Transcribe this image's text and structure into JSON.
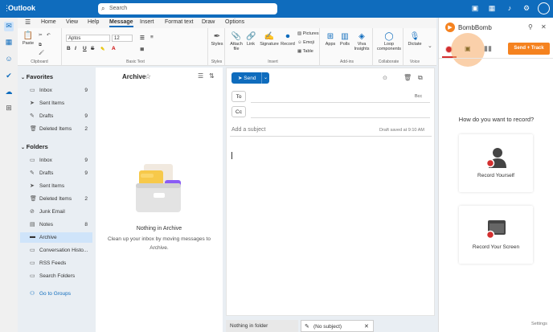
{
  "app": {
    "title": "Outlook"
  },
  "search": {
    "placeholder": "Search"
  },
  "ribbon": {
    "tabs": [
      "Home",
      "View",
      "Help",
      "Message",
      "Insert",
      "Format text",
      "Draw",
      "Options"
    ],
    "active_tab": "Message",
    "groups": {
      "clipboard": {
        "label": "Clipboard",
        "paste": "Paste"
      },
      "basic_text": {
        "label": "Basic Text",
        "font": "Aptos",
        "size": "12"
      },
      "styles": {
        "label": "Styles",
        "styles_btn": "Styles"
      },
      "insert": {
        "label": "Insert",
        "attach": "Attach file",
        "link": "Link",
        "signature": "Signature",
        "record": "Record",
        "pictures": "Pictures",
        "emoji": "Emoji",
        "table": "Table"
      },
      "addins": {
        "label": "Add-ins",
        "apps": "Apps",
        "polls": "Polls",
        "viva": "Viva Insights"
      },
      "collaborate": {
        "label": "Collaborate",
        "loop": "Loop components"
      },
      "voice": {
        "label": "Voice",
        "dictate": "Dictate"
      }
    }
  },
  "folders": {
    "favorites_header": "Favorites",
    "favorites": [
      {
        "label": "Inbox",
        "count": "9"
      },
      {
        "label": "Sent Items",
        "count": ""
      },
      {
        "label": "Drafts",
        "count": "9"
      },
      {
        "label": "Deleted Items",
        "count": "2"
      }
    ],
    "folders_header": "Folders",
    "items": [
      {
        "label": "Inbox",
        "count": "9"
      },
      {
        "label": "Drafts",
        "count": "9"
      },
      {
        "label": "Sent Items",
        "count": ""
      },
      {
        "label": "Deleted Items",
        "count": "2"
      },
      {
        "label": "Junk Email",
        "count": ""
      },
      {
        "label": "Notes",
        "count": "8"
      },
      {
        "label": "Archive",
        "count": ""
      },
      {
        "label": "Conversation Histo...",
        "count": ""
      },
      {
        "label": "RSS Feeds",
        "count": ""
      },
      {
        "label": "Search Folders",
        "count": ""
      }
    ],
    "go_to_groups": "Go to Groups"
  },
  "message_list": {
    "title": "Archive",
    "empty_title": "Nothing in Archive",
    "empty_desc": "Clean up your inbox by moving messages to Archive."
  },
  "compose": {
    "send": "Send",
    "to": "To",
    "bcc": "Bcc",
    "cc": "Cc",
    "subject_placeholder": "Add a subject",
    "draft_saved": "Draft saved at 9:10 AM"
  },
  "bottom_tabs": {
    "tab1": "Nothing in folder",
    "tab2": "(No subject)"
  },
  "panel": {
    "title": "BombBomb",
    "send_track": "Send + Track",
    "question": "How do you want to record?",
    "record_yourself": "Record Yourself",
    "record_screen": "Record Your Screen",
    "settings": "Settings"
  },
  "colors": {
    "brand": "#0f6cbd",
    "bombbomb": "#f5821f",
    "record_red": "#d32f2f"
  }
}
